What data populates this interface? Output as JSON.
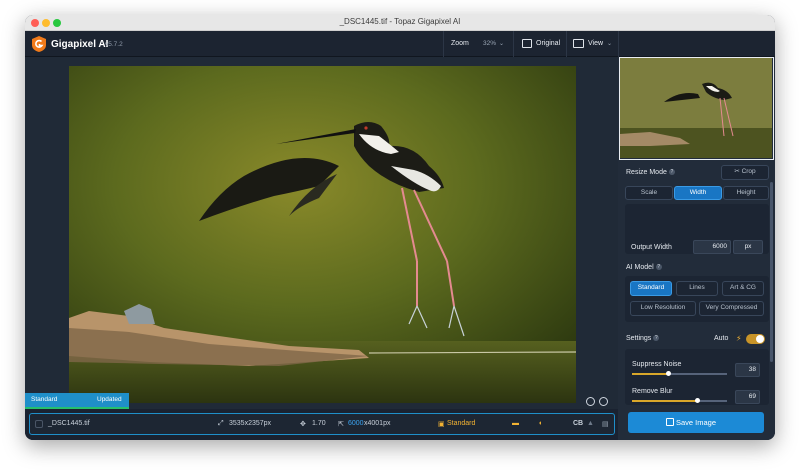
{
  "window": {
    "title": "_DSC1445.tif - Topaz Gigapixel AI"
  },
  "toolbar": {
    "app_name": "Gigapixel AI",
    "version": "v5.7.2",
    "zoom_label": "Zoom",
    "zoom_value": "32%",
    "original_label": "Original",
    "view_label": "View"
  },
  "compare": {
    "left_label": "Standard",
    "right_label": "Updated"
  },
  "bottom_bar": {
    "filename": "_DSC1445.tif",
    "input_size": "3535x2357px",
    "scale": "1.70",
    "output_width": "6000",
    "output_height_suffix": "x4001px",
    "model": "Standard",
    "cb_label": "CB"
  },
  "resize": {
    "label": "Resize Mode",
    "crop_label": "Crop",
    "tabs": [
      "Scale",
      "Width",
      "Height"
    ],
    "active_tab": "Width",
    "output_label": "Output Width",
    "output_value": "6000",
    "unit": "px"
  },
  "ai_model": {
    "label": "AI Model",
    "options_row1": [
      "Standard",
      "Lines",
      "Art & CG"
    ],
    "options_row2": [
      "Low Resolution",
      "Very Compressed"
    ],
    "active": "Standard"
  },
  "settings": {
    "label": "Settings",
    "auto_label": "Auto",
    "auto_on": true,
    "suppress_noise_label": "Suppress Noise",
    "suppress_noise_value": "38",
    "remove_blur_label": "Remove Blur",
    "remove_blur_value": "69"
  },
  "save": {
    "label": "Save Image"
  },
  "colors": {
    "accent": "#1c8ad6",
    "active_button": "#1976c4",
    "model_highlight": "#f2b233",
    "panel_bg": "#222c3a"
  },
  "icons": [
    "gigapixel-logo-icon",
    "chevron-down-icon",
    "original-image-icon",
    "view-layout-icon",
    "crop-icon",
    "help-icon",
    "bolt-icon",
    "image-size-icon",
    "scale-icon",
    "output-size-icon",
    "model-icon",
    "preview-panel-icon",
    "sound-icon",
    "person-icon",
    "trash-icon",
    "save-icon",
    "face-recovery-icon"
  ]
}
